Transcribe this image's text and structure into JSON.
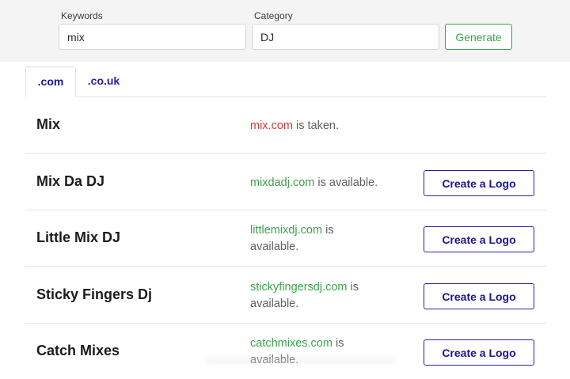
{
  "search": {
    "keywords_label": "Keywords",
    "keywords_value": "mix",
    "category_label": "Category",
    "category_value": "DJ",
    "generate_label": "Generate"
  },
  "tabs": [
    {
      "label": ".com",
      "active": true
    },
    {
      "label": ".co.uk",
      "active": false
    }
  ],
  "results": [
    {
      "name": "Mix",
      "domain": "mix.com",
      "status_text": "is taken.",
      "available": false
    },
    {
      "name": "Mix Da DJ",
      "domain": "mixdadj.com",
      "status_text": "is available.",
      "available": true,
      "button_label": "Create a Logo"
    },
    {
      "name": "Little Mix DJ",
      "domain": "littlemixdj.com",
      "status_text": "is available.",
      "available": true,
      "button_label": "Create a Logo"
    },
    {
      "name": "Sticky Fingers Dj",
      "domain": "stickyfingersdj.com",
      "status_text": "is available.",
      "available": true,
      "button_label": "Create a Logo"
    },
    {
      "name": "Catch Mixes",
      "domain": "catchmixes.com",
      "status_text": "is available.",
      "available": true,
      "button_label": "Create a Logo"
    }
  ],
  "colors": {
    "taken": "#d93a3a",
    "available": "#3aa34a",
    "accent": "#2b1fa8"
  }
}
